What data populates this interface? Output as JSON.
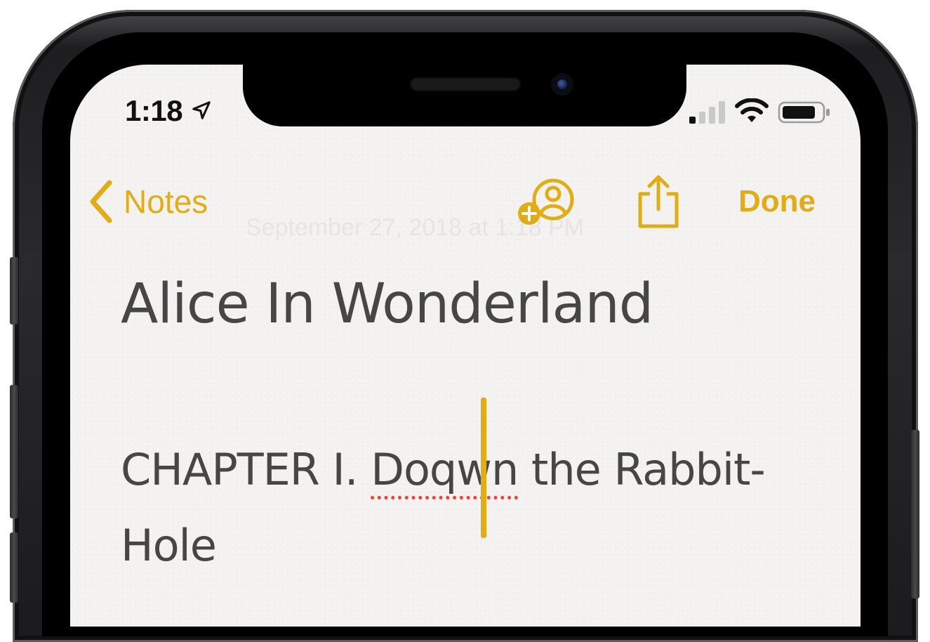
{
  "status_bar": {
    "time": "1:18",
    "icons": [
      "location-arrow-icon",
      "signal-icon",
      "wifi-icon",
      "battery-icon"
    ]
  },
  "nav": {
    "back_label": "Notes",
    "done_label": "Done",
    "icons": [
      "chevron-left-icon",
      "add-person-icon",
      "share-icon"
    ]
  },
  "note": {
    "date": "September 27, 2018 at 1:18 PM",
    "title": "Alice In Wonderland",
    "body_before": "CHAPTER I. ",
    "misspelled_word": "Doqwn",
    "body_after": " the Rabbit-Hole"
  },
  "colors": {
    "accent": "#e2ac13",
    "text": "#464646",
    "spellcheck": "#ff3b30",
    "paper": "#f3f2f0"
  }
}
